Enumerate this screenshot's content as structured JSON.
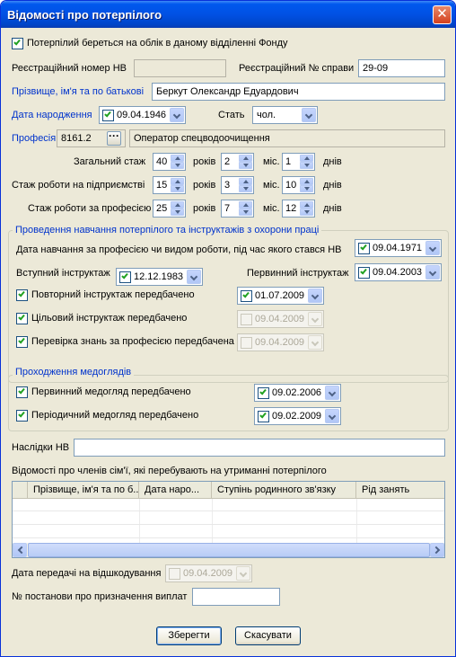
{
  "window": {
    "title": "Відомості про потерпілого",
    "close_glyph": "✕"
  },
  "registered": {
    "label": "Потерпілий береться на облік в даному відділенні Фонду",
    "checked": true
  },
  "reg_number": {
    "label": "Реєстраційний номер НВ",
    "value": ""
  },
  "case_number": {
    "label": "Реєстраційний № справи",
    "value": "29-09"
  },
  "full_name": {
    "label": "Прізвище, ім'я та по батькові",
    "value": "Беркут Олександр Едуардович"
  },
  "birth_date": {
    "label": "Дата народження",
    "value": "09.04.1946",
    "checked": true
  },
  "gender": {
    "label": "Стать",
    "value": "чол."
  },
  "profession": {
    "label": "Професія",
    "code": "8161.2",
    "lookup_glyph": "···",
    "name": "Оператор спецводоочищення"
  },
  "experience": {
    "years_label": "років",
    "months_label": "міс.",
    "days_label": "днів",
    "rows": [
      {
        "label": "Загальний стаж",
        "years": "40",
        "months": "2",
        "days": "1"
      },
      {
        "label": "Стаж роботи на підприємстві",
        "years": "15",
        "months": "3",
        "days": "10"
      },
      {
        "label": "Стаж роботи за професією",
        "years": "25",
        "months": "7",
        "days": "12"
      }
    ]
  },
  "training": {
    "title": "Проведення навчання потерпілого та інструктажів з охорони праці",
    "training_date": {
      "label": "Дата навчання за професією чи видом роботи, під час якого стався НВ",
      "value": "09.04.1971"
    },
    "intro_briefing": {
      "label": "Вступний інструктаж",
      "value": "12.12.1983"
    },
    "primary_briefing": {
      "label": "Первинний інструктаж",
      "value": "09.04.2003"
    },
    "repeat_briefing": {
      "label": "Повторний інструктаж передбачено",
      "value": "01.07.2009"
    },
    "target_briefing": {
      "label": "Цільовий інструктаж передбачено",
      "value": "09.04.2009"
    },
    "knowledge_check": {
      "label": "Перевірка знань за професією передбачена",
      "value": "09.04.2009"
    }
  },
  "medical": {
    "title": "Проходження медоглядів",
    "primary_exam": {
      "label": "Первинний медогляд передбачено",
      "value": "09.02.2006"
    },
    "periodic_exam": {
      "label": "Періодичний медогляд передбачено",
      "value": "09.02.2009"
    }
  },
  "consequences": {
    "label": "Наслідки НВ",
    "value": ""
  },
  "family": {
    "label": "Відомості про членів сім'ї, які перебувають на утриманні потерпілого",
    "columns": [
      "Прізвище, ім'я та по б...",
      "Дата наро...",
      "Ступінь родинного зв'язку",
      "Рід занять"
    ],
    "rows": []
  },
  "transfer_date": {
    "label": "Дата передачі на відшкодування",
    "value": "09.04.2009"
  },
  "resolution_number": {
    "label": "№ постанови про призначення виплат",
    "value": ""
  },
  "buttons": {
    "save": "Зберегти",
    "cancel": "Скасувати"
  },
  "colors": {
    "title_bar": "#0058ee",
    "link": "#0033cc",
    "checkmark": "#21a121",
    "dialog_bg": "#ece9d8"
  }
}
